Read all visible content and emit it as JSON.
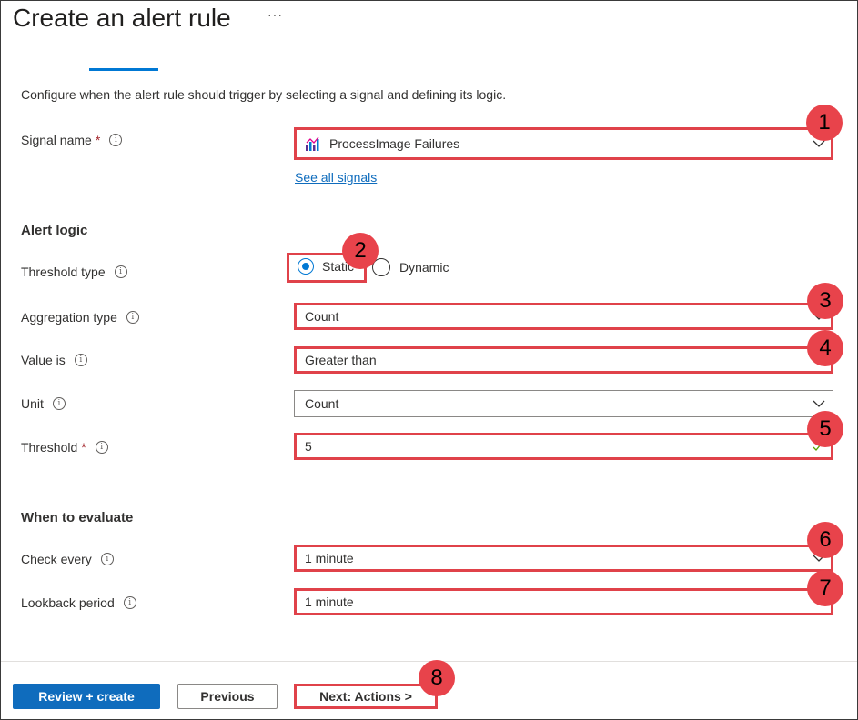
{
  "header": {
    "title": "Create an alert rule",
    "more": "···"
  },
  "description": "Configure when the alert rule should trigger by selecting a signal and defining its logic.",
  "signal": {
    "label": "Signal name",
    "required": "*",
    "value": "ProcessImage Failures",
    "see_all": "See all signals"
  },
  "alert_logic": {
    "heading": "Alert logic",
    "threshold_type": {
      "label": "Threshold type",
      "options": [
        "Static",
        "Dynamic"
      ],
      "selected": "Static"
    },
    "aggregation_type": {
      "label": "Aggregation type",
      "value": "Count"
    },
    "value_is": {
      "label": "Value is",
      "value": "Greater than"
    },
    "unit": {
      "label": "Unit",
      "value": "Count"
    },
    "threshold": {
      "label": "Threshold",
      "required": "*",
      "value": "5"
    }
  },
  "evaluate": {
    "heading": "When to evaluate",
    "check_every": {
      "label": "Check every",
      "value": "1 minute"
    },
    "lookback": {
      "label": "Lookback period",
      "value": "1 minute"
    }
  },
  "footer": {
    "review_create": "Review + create",
    "previous": "Previous",
    "next": "Next: Actions >"
  },
  "callouts": [
    "1",
    "2",
    "3",
    "4",
    "5",
    "6",
    "7",
    "8"
  ],
  "colors": {
    "accent": "#0078d4",
    "primary_button": "#0f6cbd",
    "callout_red": "#e0424a",
    "required": "#a4262c"
  },
  "icons": {
    "info": "info-circle-icon",
    "dropdown": "chevron-down-icon",
    "signal": "metric-chart-icon",
    "valid": "checkmark-icon"
  }
}
